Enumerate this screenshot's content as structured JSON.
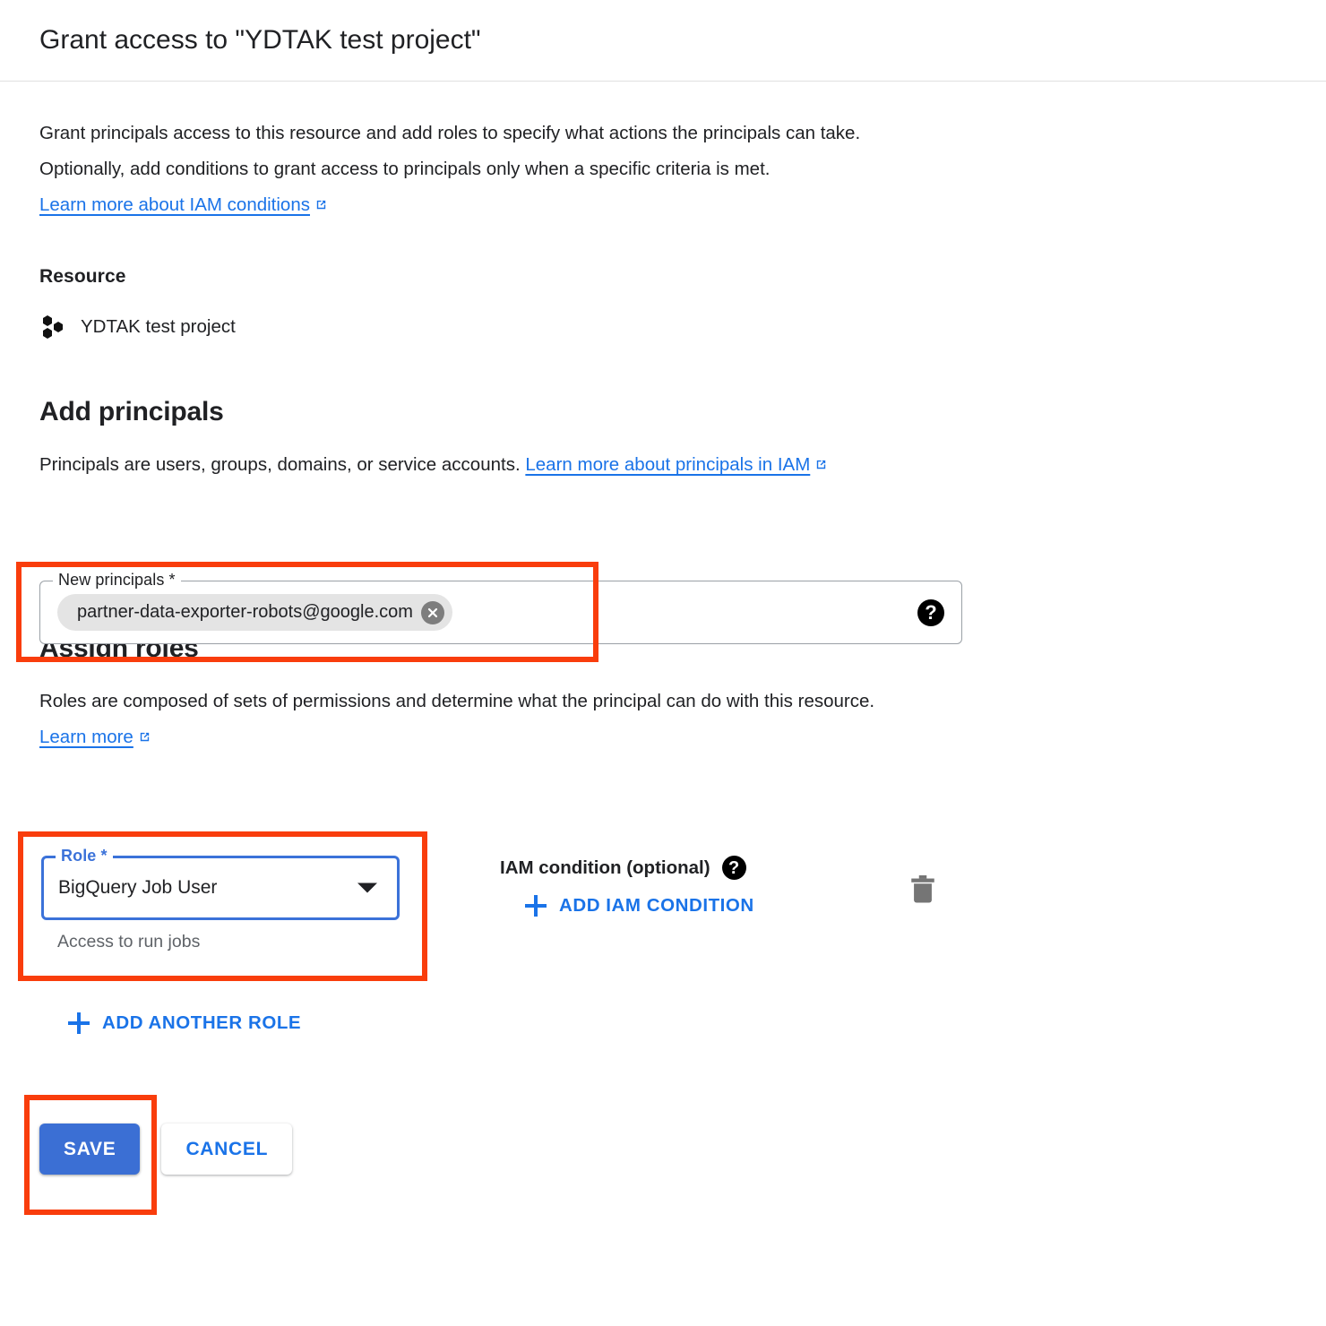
{
  "header": {
    "title": "Grant access to \"YDTAK test project\""
  },
  "intro": {
    "text": "Grant principals access to this resource and add roles to specify what actions the principals can take. Optionally, add conditions to grant access to principals only when a specific criteria is met.",
    "link_label": "Learn more about IAM conditions",
    "link_icon": "external-link-icon"
  },
  "resource": {
    "heading": "Resource",
    "icon": "project-icon",
    "name": "YDTAK test project"
  },
  "principals": {
    "heading": "Add principals",
    "description": "Principals are users, groups, domains, or service accounts.",
    "link_label": "Learn more about principals in IAM",
    "link_icon": "external-link-icon",
    "field_label": "New principals *",
    "chip_value": "partner-data-exporter-robots@google.com",
    "chip_remove_icon": "close-circle-icon",
    "help_icon": "help-icon",
    "help_glyph": "?"
  },
  "roles": {
    "heading": "Assign roles",
    "description": "Roles are composed of sets of permissions and determine what the principal can do with this resource.",
    "link_label": "Learn more",
    "link_icon": "external-link-icon",
    "role_label": "Role *",
    "role_value": "BigQuery Job User",
    "role_hint": "Access to run jobs",
    "dropdown_icon": "chevron-down-icon",
    "iam_condition_label": "IAM condition (optional)",
    "iam_help_glyph": "?",
    "add_iam_condition_label": "ADD IAM CONDITION",
    "delete_icon": "trash-icon",
    "add_another_role_label": "ADD ANOTHER ROLE"
  },
  "footer": {
    "save_label": "SAVE",
    "cancel_label": "CANCEL"
  },
  "colors": {
    "accent_blue": "#1a73e8",
    "save_blue": "#3b6fd4",
    "focus_blue": "#3b72d9",
    "highlight_red": "#f93d0c",
    "chip_grey": "#e4e4e4",
    "hint_grey": "#5f6368"
  }
}
